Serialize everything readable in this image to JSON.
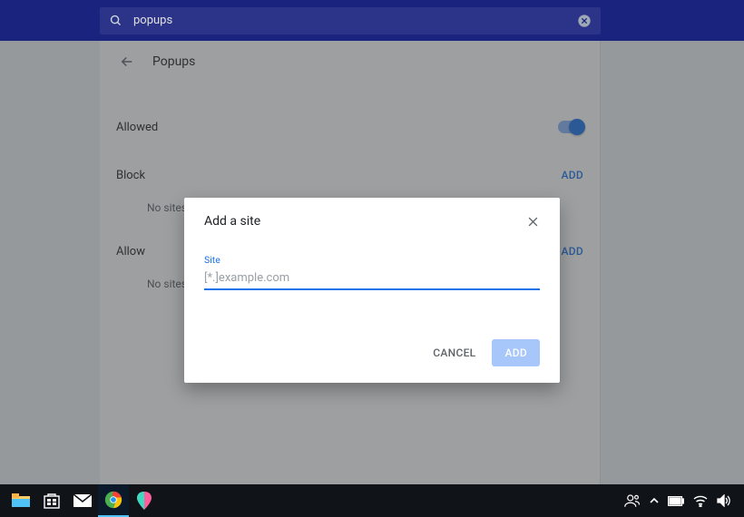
{
  "searchbar": {
    "query": "popups"
  },
  "page": {
    "title": "Popups",
    "allowed_label": "Allowed",
    "block": {
      "label": "Block",
      "add_label": "ADD",
      "empty_text": "No sites added"
    },
    "allow": {
      "label": "Allow",
      "add_label": "ADD",
      "empty_text": "No sites added"
    }
  },
  "dialog": {
    "title": "Add a site",
    "field_label": "Site",
    "placeholder": "[*.]example.com",
    "cancel_label": "CANCEL",
    "add_label": "ADD"
  }
}
